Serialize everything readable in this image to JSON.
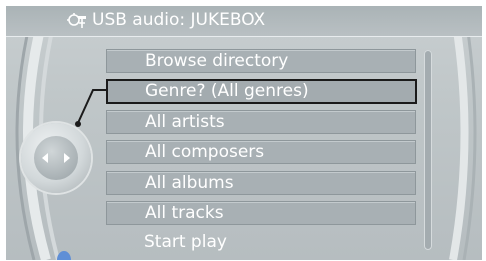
{
  "header": {
    "title": "USB audio: JUKEBOX",
    "icon": "usb-audio-icon"
  },
  "controller": {
    "icon": "controller-knob-icon"
  },
  "menu": {
    "items": [
      {
        "label": "Browse directory"
      },
      {
        "label": "Genre? (All genres)",
        "selected": true
      },
      {
        "label": "All artists"
      },
      {
        "label": "All composers"
      },
      {
        "label": "All albums"
      },
      {
        "label": "All tracks"
      },
      {
        "label": "Start play"
      }
    ]
  },
  "colors": {
    "background": "#c3c9cb",
    "item": "#a8b0b4",
    "text": "#ffffff",
    "selection": "#1b1b1b"
  }
}
